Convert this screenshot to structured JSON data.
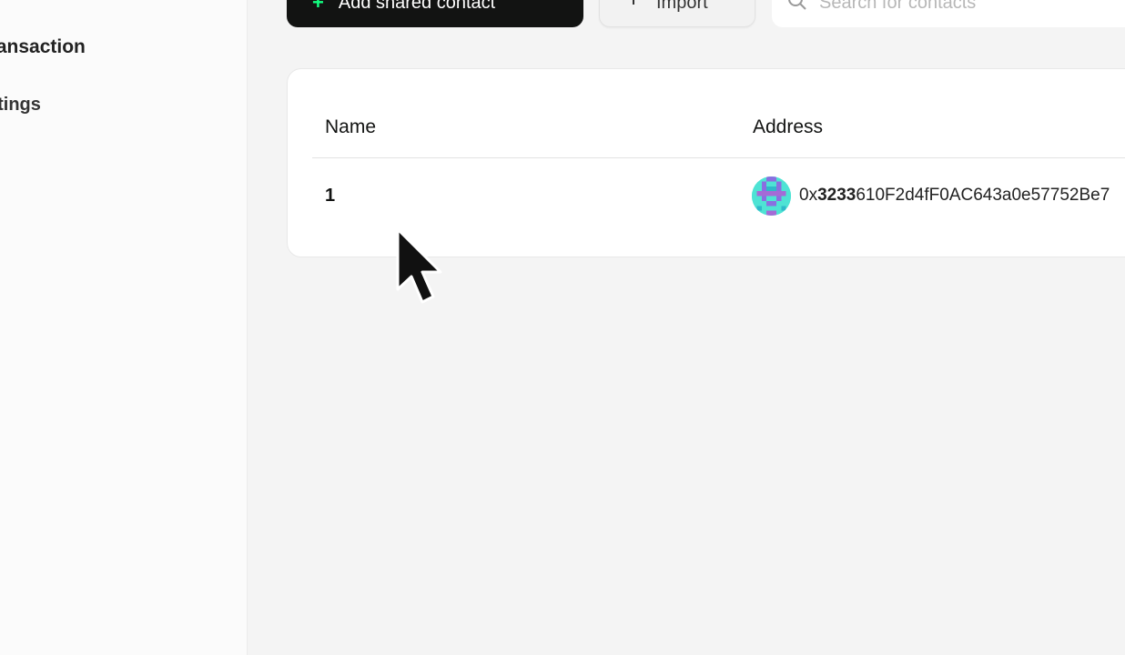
{
  "sidebar": {
    "items": [
      {
        "label": "Transaction"
      },
      {
        "label": "Settings"
      }
    ]
  },
  "toolbar": {
    "add_label": "Add shared contact",
    "import_label": "Import",
    "search_placeholder": "Search for contacts"
  },
  "table": {
    "columns": [
      "Name",
      "Address"
    ],
    "rows": [
      {
        "name": "1",
        "address_prefix": "0x",
        "address_bold": "3233",
        "address_rest": "610F2d4fF0AC643a0e57752Be7"
      }
    ]
  },
  "colors": {
    "accent": "#12ff80",
    "button_dark": "#121312",
    "avatar": "#4ee3d4"
  }
}
